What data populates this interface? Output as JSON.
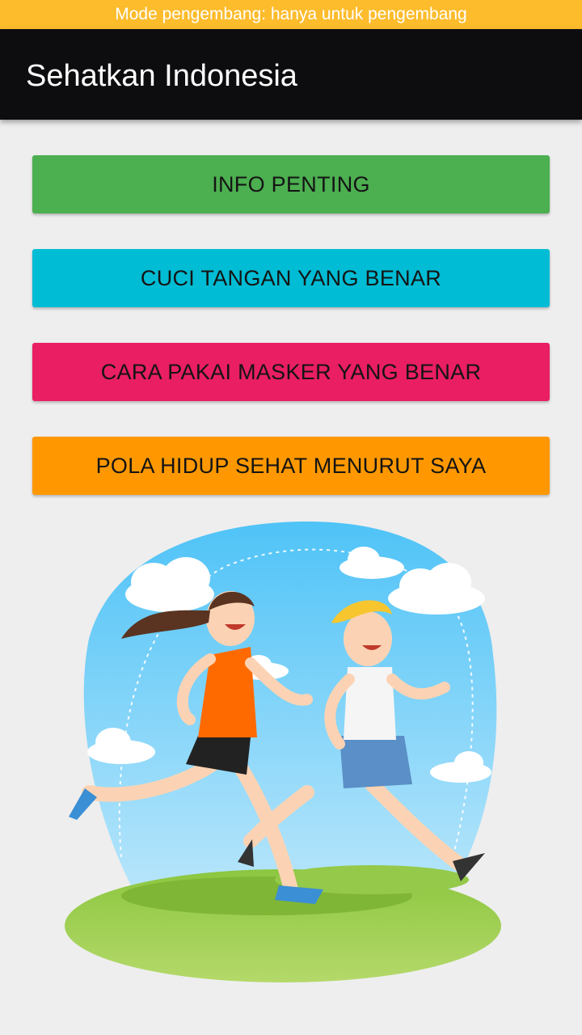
{
  "system": {
    "dev_mode_banner": "Mode pengembang: hanya untuk pengembang"
  },
  "app_bar": {
    "title": "Sehatkan Indonesia"
  },
  "menu": {
    "buttons": [
      {
        "label": "INFO PENTING",
        "color": "#4caf50"
      },
      {
        "label": "CUCI TANGAN YANG BENAR",
        "color": "#00bcd4"
      },
      {
        "label": "CARA PAKAI MASKER YANG BENAR",
        "color": "#e91e63"
      },
      {
        "label": "POLA HIDUP SEHAT MENURUT SAYA",
        "color": "#ff9800"
      }
    ]
  },
  "illustration": {
    "icon": "running-couple-illustration",
    "colors": {
      "sky": "#5ec8f7",
      "grass": "#8cc63f",
      "woman_shirt": "#ff6a00",
      "man_shorts": "#5b8fc7"
    }
  }
}
